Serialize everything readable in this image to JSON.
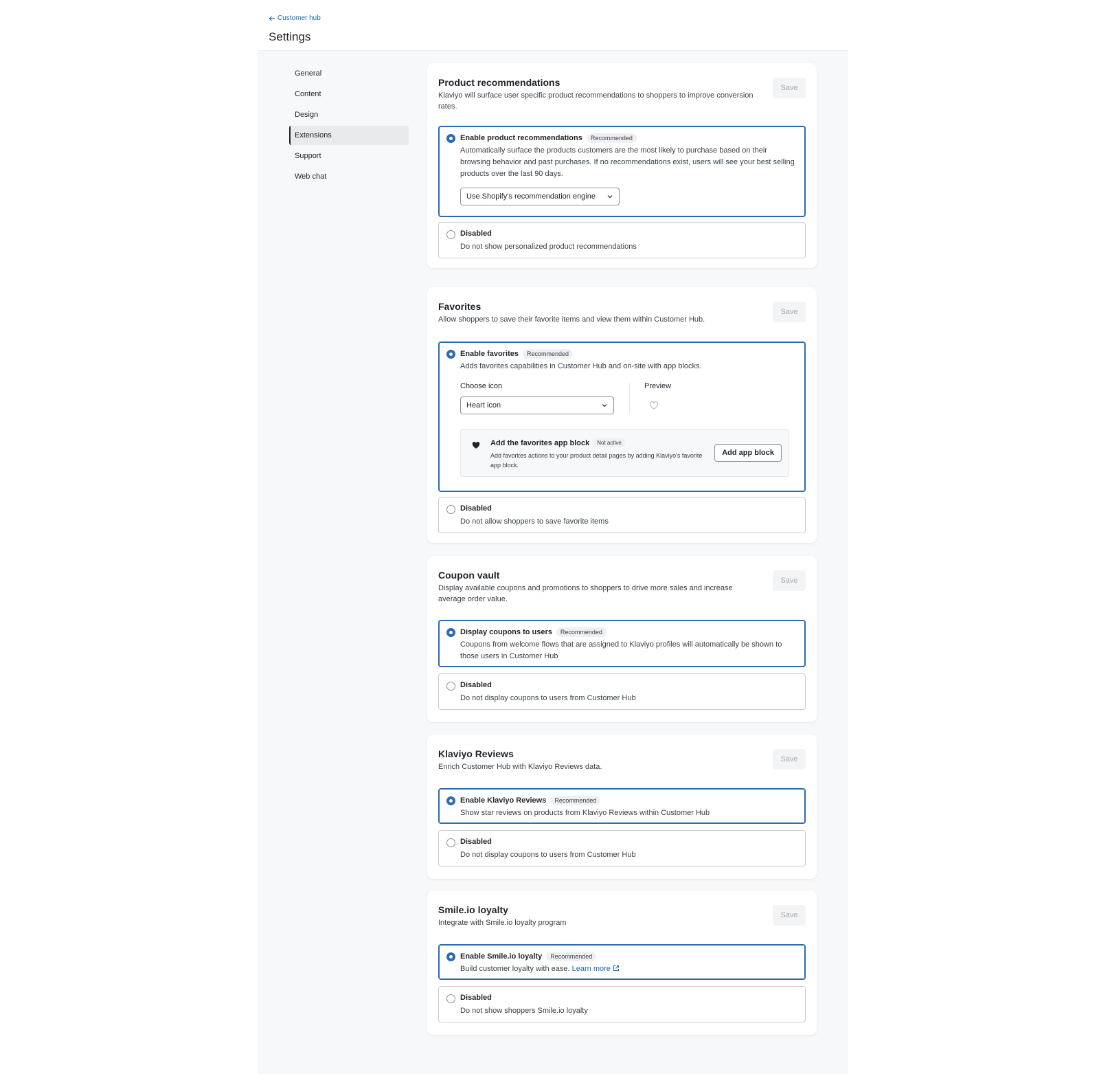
{
  "header": {
    "back_label": "Customer hub",
    "title": "Settings"
  },
  "nav": {
    "items": [
      "General",
      "Content",
      "Design",
      "Extensions",
      "Support",
      "Web chat"
    ],
    "active": "Extensions"
  },
  "sections": {
    "product_recommendations": {
      "title": "Product recommendations",
      "description": "Klaviyo will surface user specific product recommendations to shoppers to improve conversion rates.",
      "save_label": "Save",
      "enable": {
        "label": "Enable product recommendations",
        "badge": "Recommended",
        "description": "Automatically surface the products customers are the most likely to purchase based on their browsing behavior and past purchases. If no recommendations exist, users will see your best selling products over the last 90 days.",
        "engine_select": "Use Shopify's recommendation engine"
      },
      "disabled": {
        "label": "Disabled",
        "description": "Do not show personalized product recommendations"
      }
    },
    "favorites": {
      "title": "Favorites",
      "description": "Allow shoppers to save their favorite items and view them within Customer Hub.",
      "save_label": "Save",
      "enable": {
        "label": "Enable favorites",
        "badge": "Recommended",
        "description": "Adds favorites capabilities in Customer Hub and on-site with app blocks.",
        "choose_icon_label": "Choose icon",
        "icon_select": "Heart icon",
        "preview_label": "Preview",
        "app_block": {
          "title": "Add the favorites app block",
          "badge": "Not active",
          "description": "Add favorites actions to your product detail pages by adding Klaviyo's favorite app block.",
          "button": "Add app block"
        }
      },
      "disabled": {
        "label": "Disabled",
        "description": "Do not allow shoppers to save favorite items"
      }
    },
    "coupon_vault": {
      "title": "Coupon vault",
      "description": "Display available coupons and promotions to shoppers to drive more sales and increase average order value.",
      "save_label": "Save",
      "enable": {
        "label": "Display coupons to users",
        "badge": "Recommended",
        "description": "Coupons from welcome flows that are assigned to Klaviyo profiles will automatically be shown to those users in Customer Hub"
      },
      "disabled": {
        "label": "Disabled",
        "description": "Do not display coupons to users from Customer Hub"
      }
    },
    "klaviyo_reviews": {
      "title": "Klaviyo Reviews",
      "description": "Enrich Customer Hub with Klaviyo Reviews data.",
      "save_label": "Save",
      "enable": {
        "label": "Enable Klaviyo Reviews",
        "badge": "Recommended",
        "description": "Show star reviews on products from Klaviyo Reviews within Customer Hub"
      },
      "disabled": {
        "label": "Disabled",
        "description": "Do not display coupons to users from Customer Hub"
      }
    },
    "smile_loyalty": {
      "title": "Smile.io loyalty",
      "description": "Integrate with Smile.io loyalty program",
      "save_label": "Save",
      "enable": {
        "label": "Enable Smile.io loyalty",
        "badge": "Recommended",
        "description": "Build customer loyalty with ease.",
        "learn_more": "Learn more"
      },
      "disabled": {
        "label": "Disabled",
        "description": "Do not show shoppers Smile.io loyalty"
      }
    }
  },
  "icons": {
    "back": "arrow-left-icon",
    "chevron": "chevron-down-icon",
    "preview": "heart-outline-icon",
    "app_block": "heart-filled-icon",
    "external": "external-link-icon"
  },
  "colors": {
    "accent": "#2c6ab4",
    "link": "#1e66b3",
    "save_disabled": "#a3a8ad"
  }
}
